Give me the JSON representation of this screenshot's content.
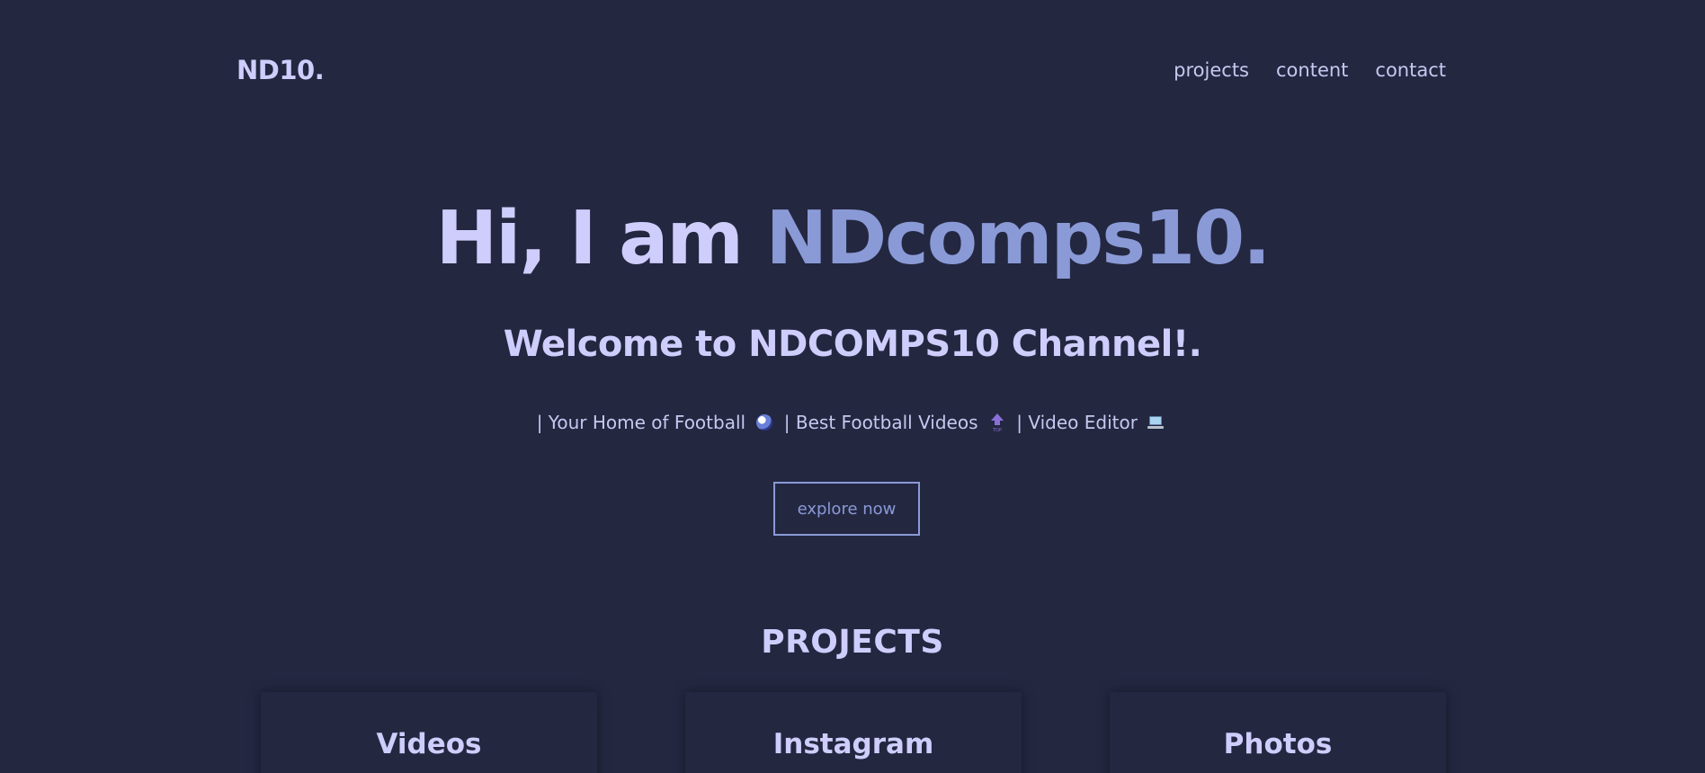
{
  "nav": {
    "logo": "ND10.",
    "links": [
      "projects",
      "content",
      "contact"
    ]
  },
  "hero": {
    "title_lead": "Hi, I am ",
    "title_accent": "NDcomps10.",
    "subtitle": "Welcome to NDCOMPS10 Channel!.",
    "tagline": {
      "part1": "| Your Home of Football",
      "part2": "| Best Football Videos",
      "part3": "| Video Editor"
    },
    "cta_label": "explore now"
  },
  "projects": {
    "heading": "PROJECTS",
    "cards": [
      {
        "title": "Videos"
      },
      {
        "title": "Instagram"
      },
      {
        "title": "Photos"
      }
    ]
  },
  "icons": {
    "tagline_icon_1": "soccer-ball-icon",
    "tagline_icon_2": "top-arrow-icon",
    "tagline_icon_3": "laptop-icon"
  },
  "colors": {
    "background": "#232740",
    "primary_text": "#cfcdfc",
    "accent": "#8a9ad7"
  }
}
